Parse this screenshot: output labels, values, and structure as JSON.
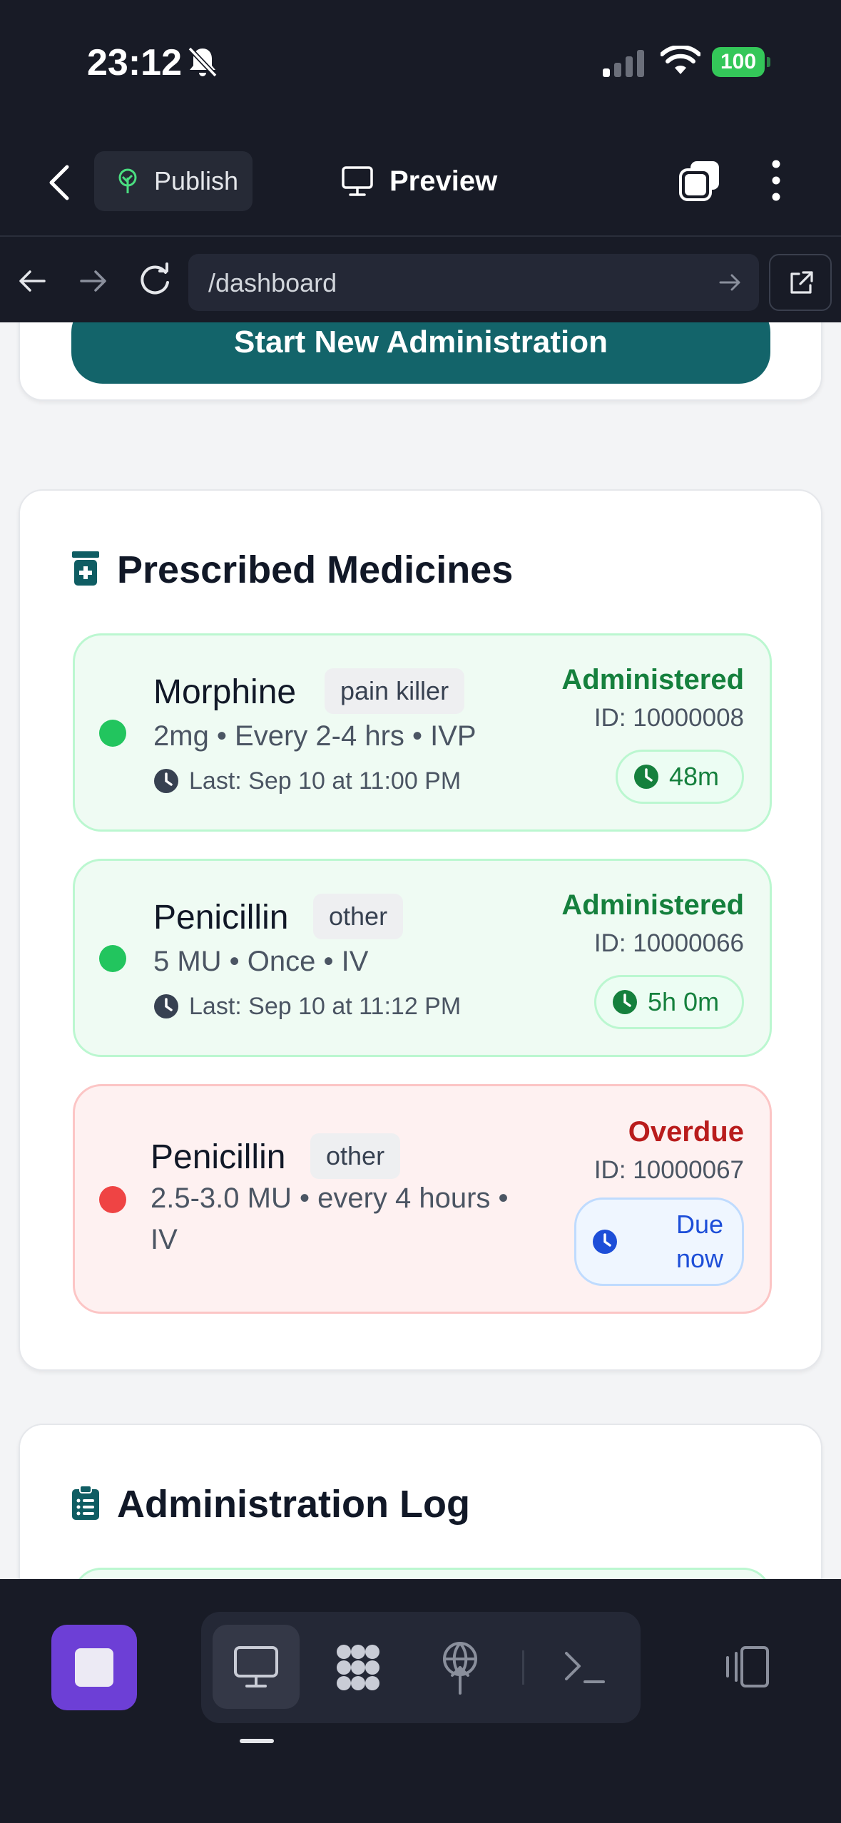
{
  "status_bar": {
    "time": "23:12",
    "battery": "100"
  },
  "header": {
    "publish_label": "Publish",
    "preview_label": "Preview"
  },
  "browser": {
    "url": "/dashboard"
  },
  "top_action": {
    "start_label": "Start New Administration"
  },
  "medicines": {
    "title": "Prescribed Medicines",
    "items": [
      {
        "name": "Morphine",
        "tag": "pain killer",
        "dose": "2mg • Every 2-4 hrs • IVP",
        "last": "Last: Sep 10 at 11:00 PM",
        "status": "Administered",
        "id": "ID: 10000008",
        "timer": "48m",
        "state": "ok"
      },
      {
        "name": "Penicillin",
        "tag": "other",
        "dose": "5 MU • Once • IV",
        "last": "Last: Sep 10 at 11:12 PM",
        "status": "Administered",
        "id": "ID: 10000066",
        "timer": "5h 0m",
        "state": "ok"
      },
      {
        "name": "Penicillin",
        "tag": "other",
        "dose_line1": "2.5-3.0 MU • every 4 hours •",
        "dose_line2": "IV",
        "status": "Overdue",
        "id": "ID: 10000067",
        "timer_line1": "Due",
        "timer_line2": "now",
        "state": "late"
      }
    ]
  },
  "log": {
    "title": "Administration Log"
  },
  "colors": {
    "chrome": "#181b26",
    "teal": "#13646a",
    "green": "#15803d",
    "red": "#b91c1c",
    "blue": "#1d4ed8",
    "purple": "#6d3fd6"
  }
}
